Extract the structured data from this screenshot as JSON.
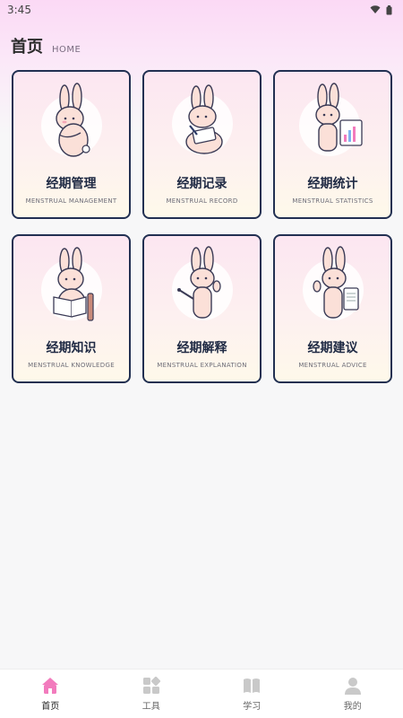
{
  "status_bar": {
    "time": "3:45"
  },
  "header": {
    "title": "首页",
    "subtitle": "HOME"
  },
  "cards": [
    {
      "title": "经期管理",
      "subtitle": "MENSTRUAL MANAGEMENT",
      "icon": "bunny-hugging-icon"
    },
    {
      "title": "经期记录",
      "subtitle": "MENSTRUAL RECORD",
      "icon": "bunny-writing-icon"
    },
    {
      "title": "经期统计",
      "subtitle": "MENSTRUAL STATISTICS",
      "icon": "bunny-chart-icon"
    },
    {
      "title": "经期知识",
      "subtitle": "MENSTRUAL KNOWLEDGE",
      "icon": "bunny-reading-icon"
    },
    {
      "title": "经期解释",
      "subtitle": "MENSTRUAL EXPLANATION",
      "icon": "bunny-pointer-icon"
    },
    {
      "title": "经期建议",
      "subtitle": "MENSTRUAL ADVICE",
      "icon": "bunny-thumbsup-icon"
    }
  ],
  "bottom_nav": [
    {
      "label": "首页",
      "icon": "home-icon",
      "active": true
    },
    {
      "label": "工具",
      "icon": "tools-icon",
      "active": false
    },
    {
      "label": "学习",
      "icon": "book-icon",
      "active": false
    },
    {
      "label": "我的",
      "icon": "user-icon",
      "active": false
    }
  ],
  "colors": {
    "accent": "#f27bbd",
    "card_border": "#223052",
    "title_text": "#1f2a44",
    "nav_inactive": "#c9c9c9"
  }
}
